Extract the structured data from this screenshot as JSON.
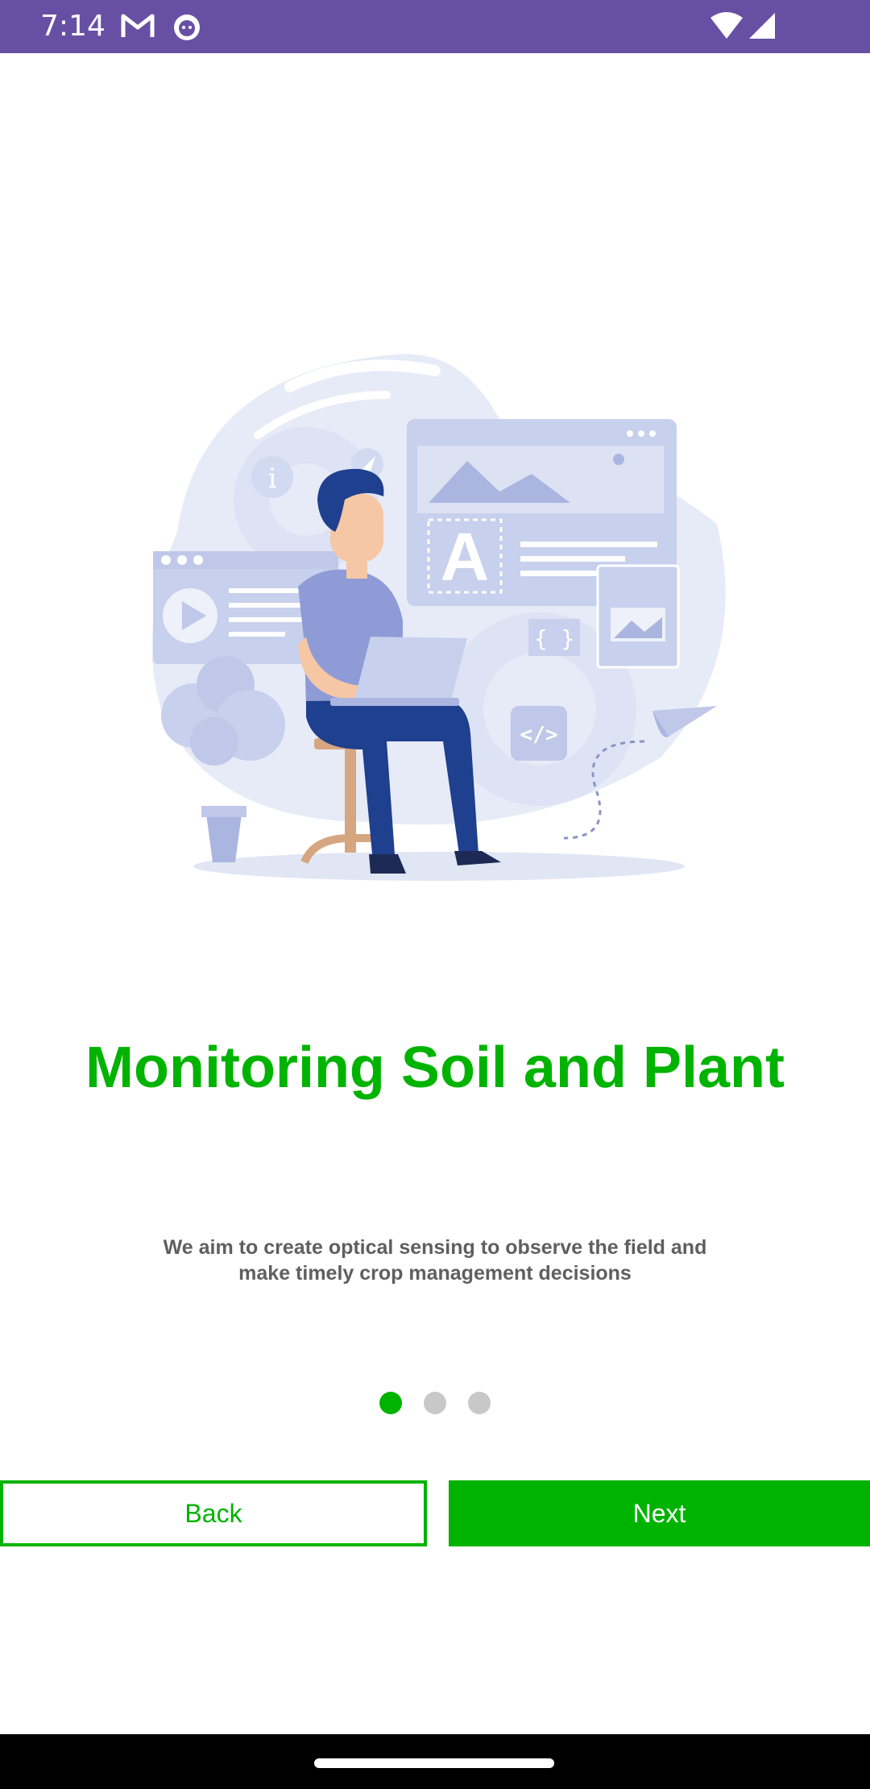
{
  "status_bar": {
    "time": "7:14",
    "icons": [
      "gmail-icon",
      "cat-face-icon",
      "wifi-icon",
      "cell-signal-icon"
    ]
  },
  "illustration": {
    "icon": "developer-at-laptop-illustration",
    "glyphs": {
      "info": "i",
      "letter": "A",
      "braces": "{ }",
      "code": "</>"
    }
  },
  "onboarding": {
    "title": "Monitoring Soil and Plant",
    "description": "We aim to create optical sensing to observe the field and make timely crop management decisions",
    "page_count": 3,
    "current_page": 1
  },
  "buttons": {
    "back_label": "Back",
    "next_label": "Next"
  },
  "colors": {
    "accent": "#00b300",
    "status_bar": "#6750a4",
    "dot_inactive": "#c8c8c8",
    "illustration_light": "#e6ebf7",
    "illustration_mid": "#bfc8e8",
    "illustration_dark": "#0d2f7a"
  }
}
